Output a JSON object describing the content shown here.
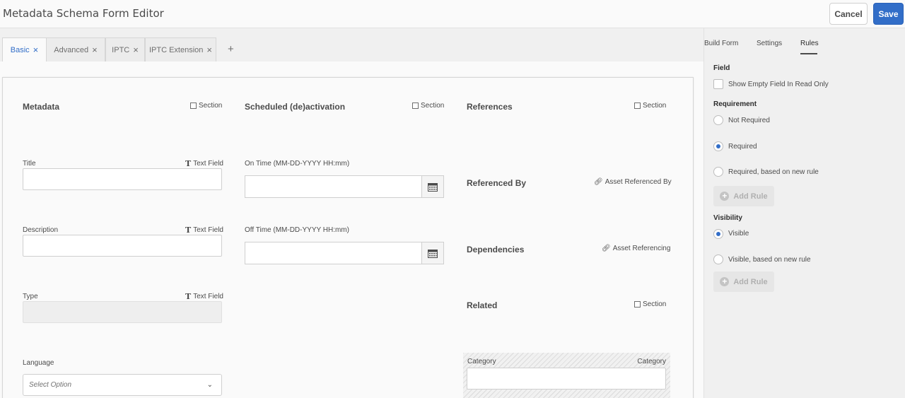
{
  "header": {
    "title": "Metadata Schema Form Editor",
    "cancel_label": "Cancel",
    "save_label": "Save"
  },
  "tabs": [
    {
      "label": "Basic",
      "active": true
    },
    {
      "label": "Advanced",
      "active": false
    },
    {
      "label": "IPTC",
      "active": false
    },
    {
      "label": "IPTC Extension",
      "active": false
    }
  ],
  "tab_add_label": "+",
  "close_glyph": "×",
  "form": {
    "metadata": {
      "title": "Metadata",
      "type_tag": "Section",
      "fields": [
        {
          "label": "Title",
          "type_tag": "Text Field",
          "value": ""
        },
        {
          "label": "Description",
          "type_tag": "Text Field",
          "value": ""
        },
        {
          "label": "Type",
          "type_tag": "Text Field",
          "value": "",
          "disabled": true
        },
        {
          "label": "Language",
          "placeholder": "Select Option"
        }
      ]
    },
    "activation": {
      "title": "Scheduled (de)activation",
      "type_tag": "Section",
      "on_time_label": "On Time (MM-DD-YYYY HH:mm)",
      "off_time_label": "Off Time (MM-DD-YYYY HH:mm)"
    },
    "references": {
      "title": "References",
      "type_tag": "Section",
      "referenced_by": {
        "title": "Referenced By",
        "type_tag": "Asset Referenced By"
      },
      "dependencies": {
        "title": "Dependencies",
        "type_tag": "Asset Referencing"
      },
      "related": {
        "title": "Related",
        "type_tag": "Section"
      },
      "category": {
        "label": "Category",
        "type_tag": "Category"
      }
    }
  },
  "right_panel": {
    "tabs": [
      "Build Form",
      "Settings",
      "Rules"
    ],
    "active_tab": "Rules",
    "field_section": "Field",
    "show_empty_label": "Show Empty Field In Read Only",
    "requirement_section": "Requirement",
    "requirement_options": [
      "Not Required",
      "Required",
      "Required, based on new rule"
    ],
    "requirement_selected": "Required",
    "add_rule_label": "Add Rule",
    "visibility_section": "Visibility",
    "visibility_options": [
      "Visible",
      "Visible, based on new rule"
    ],
    "visibility_selected": "Visible"
  },
  "colors": {
    "accent": "#326ec8",
    "background": "#f0f0f0",
    "text": "#4b4b4b"
  }
}
